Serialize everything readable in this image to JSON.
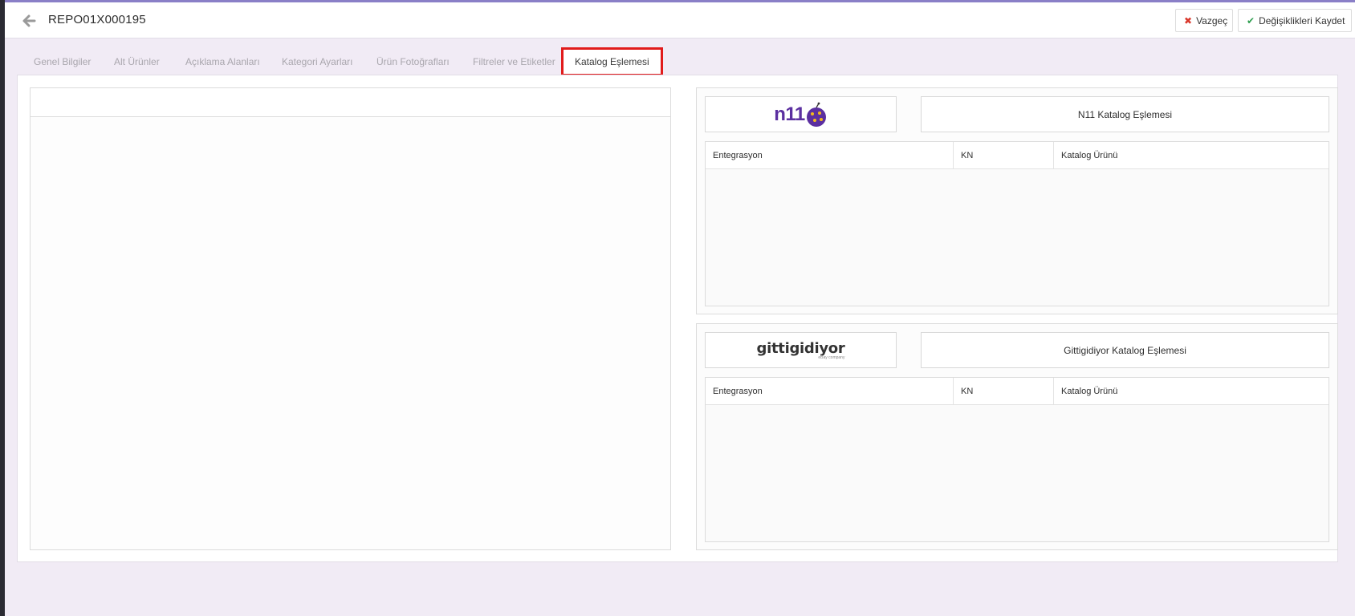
{
  "header": {
    "record_code": "REPO01X000195",
    "cancel_label": "Vazgeç",
    "save_label": "Değişiklikleri Kaydet"
  },
  "tabs": [
    {
      "label": "Genel Bilgiler",
      "active": false
    },
    {
      "label": "Alt Ürünler",
      "active": false
    },
    {
      "label": "Açıklama Alanları",
      "active": false
    },
    {
      "label": "Kategori Ayarları",
      "active": false
    },
    {
      "label": "Ürün Fotoğrafları",
      "active": false
    },
    {
      "label": "Filtreler ve Etiketler",
      "active": false
    },
    {
      "label": "Katalog Eşlemesi",
      "active": true
    }
  ],
  "marketplaces": {
    "n11": {
      "logo_text": "n11",
      "match_button_label": "N11 Katalog Eşlemesi",
      "columns": [
        "Entegrasyon",
        "KN",
        "Katalog Ürünü"
      ],
      "rows": []
    },
    "gittigidiyor": {
      "logo_text": "gittigidiyor",
      "logo_subtext": "eBay company",
      "match_button_label": "Gittigidiyor Katalog Eşlemesi",
      "columns": [
        "Entegrasyon",
        "KN",
        "Katalog Ürünü"
      ],
      "rows": []
    }
  },
  "colors": {
    "accent": "#8a7fc7",
    "background": "#f1ebf5",
    "active_tab_border": "#e11b1b",
    "n11_brand": "#5b2fa0"
  }
}
